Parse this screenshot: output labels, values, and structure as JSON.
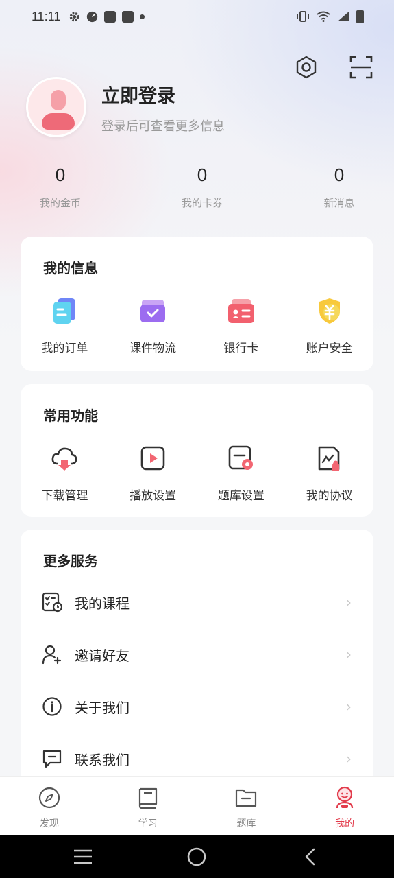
{
  "status_bar": {
    "time": "11:11"
  },
  "profile": {
    "title": "立即登录",
    "subtitle": "登录后可查看更多信息"
  },
  "stats": [
    {
      "value": "0",
      "label": "我的金币"
    },
    {
      "value": "0",
      "label": "我的卡券"
    },
    {
      "value": "0",
      "label": "新消息"
    }
  ],
  "my_info": {
    "title": "我的信息",
    "items": [
      {
        "label": "我的订单",
        "icon": "orders-icon"
      },
      {
        "label": "课件物流",
        "icon": "logistics-icon"
      },
      {
        "label": "银行卡",
        "icon": "bank-card-icon"
      },
      {
        "label": "账户安全",
        "icon": "account-security-icon"
      }
    ]
  },
  "common": {
    "title": "常用功能",
    "items": [
      {
        "label": "下载管理",
        "icon": "cloud-download-icon"
      },
      {
        "label": "播放设置",
        "icon": "play-settings-icon"
      },
      {
        "label": "题库设置",
        "icon": "question-bank-settings-icon"
      },
      {
        "label": "我的协议",
        "icon": "agreement-icon"
      }
    ]
  },
  "more": {
    "title": "更多服务",
    "items": [
      {
        "label": "我的课程",
        "icon": "course-icon"
      },
      {
        "label": "邀请好友",
        "icon": "invite-friend-icon"
      },
      {
        "label": "关于我们",
        "icon": "info-icon"
      },
      {
        "label": "联系我们",
        "icon": "message-icon"
      }
    ]
  },
  "tabs": [
    {
      "label": "发现",
      "icon": "compass-icon"
    },
    {
      "label": "学习",
      "icon": "book-icon"
    },
    {
      "label": "题库",
      "icon": "folder-icon"
    },
    {
      "label": "我的",
      "icon": "smiley-person-icon",
      "active": true
    }
  ],
  "colors": {
    "accent": "#e23b4b",
    "background": "#f5f6f8"
  }
}
